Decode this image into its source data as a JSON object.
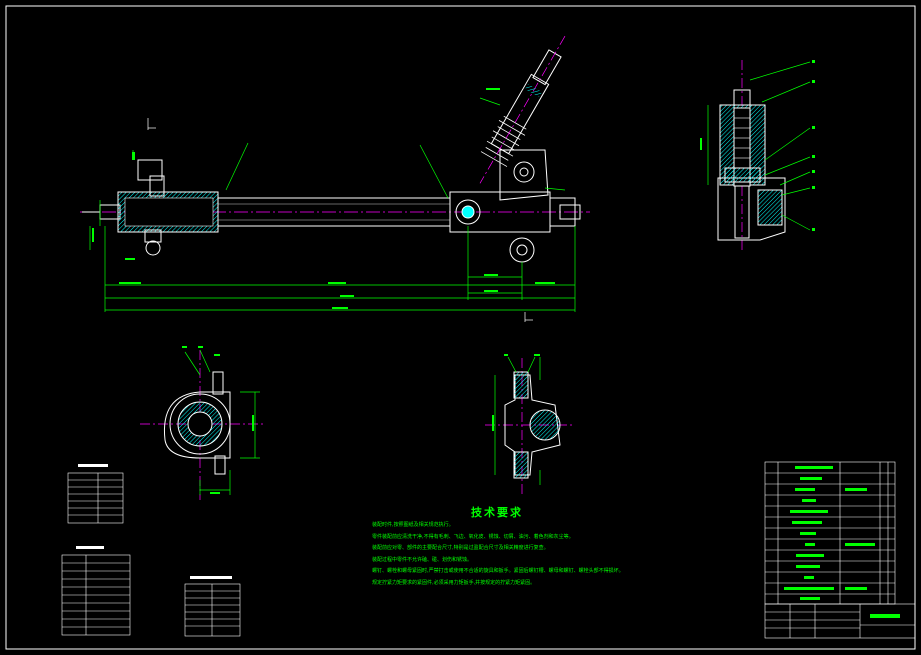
{
  "technical_requirements": {
    "title": "技术要求",
    "lines": [
      "装配时件,按照图纸及相关规范执行。",
      "零件装配前应清洗干净,不得有毛刺、飞边、氧化皮、锈蚀、切屑、油污、着色剂和灰尘等。",
      "装配前应对零、部件的主要配合尺寸,特别是过盈配合尺寸及相关精度进行复查。",
      "装配过程中零件不允许磕、碰、划伤和锈蚀。",
      "螺钉、螺栓和螺母紧固时,严禁打击或使用不合适的旋具和扳手。紧固后螺钉槽、螺母和螺钉、螺栓头部不得损坏。",
      "规定拧紧力矩要求的紧固件,必须采用力矩扳手,并按规定的拧紧力矩紧固。"
    ]
  },
  "colors": {
    "background": "#000000",
    "outline": "#ffffff",
    "dimension": "#00ff00",
    "center_line": "#ff00ff",
    "section_fill": "#00ffff",
    "hidden_line": "#ffff00"
  }
}
